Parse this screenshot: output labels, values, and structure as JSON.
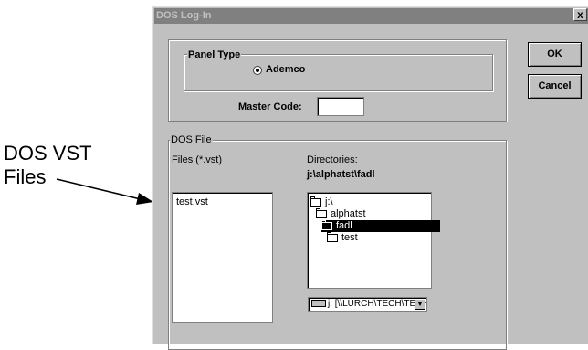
{
  "callout": {
    "line1": "DOS VST",
    "line2": "Files"
  },
  "window": {
    "title": "DOS Log-In",
    "close_label": "x"
  },
  "panel_type": {
    "label": "Panel Type",
    "option": "Ademco",
    "selected": true
  },
  "master_code": {
    "label": "Master Code:",
    "value": ""
  },
  "buttons": {
    "ok": "OK",
    "cancel": "Cancel"
  },
  "dos_file": {
    "label": "DOS File",
    "files_label": "Files (*.vst)",
    "files": [
      "test.vst"
    ],
    "directories_label": "Directories:",
    "current_dir": "j:\\alphatst\\fadl",
    "directories": [
      {
        "label": "j:\\",
        "selected": false
      },
      {
        "label": "alphatst",
        "selected": false
      },
      {
        "label": "fadl",
        "selected": true
      },
      {
        "label": "test",
        "selected": false
      }
    ],
    "drive": "j: [\\\\LURCH\\TECH\\TECH_S...]"
  }
}
